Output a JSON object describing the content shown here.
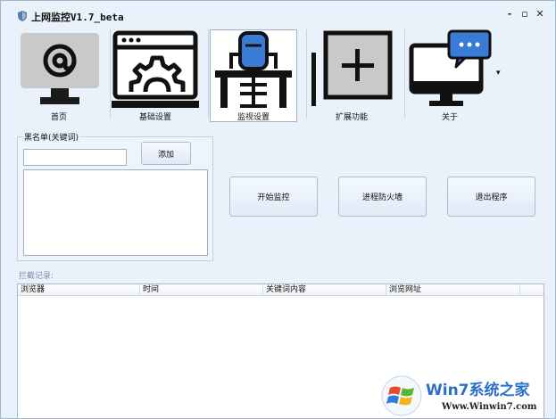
{
  "window": {
    "title": "上网监控V1.7_beta",
    "controls": {
      "min": "-",
      "max": "▫",
      "close": "✕"
    }
  },
  "toolbar": {
    "items": [
      {
        "label": "首页",
        "icon": "at-sign-monitor-icon"
      },
      {
        "label": "基础设置",
        "icon": "gear-window-icon"
      },
      {
        "label": "监视设置",
        "icon": "desk-chair-icon"
      },
      {
        "label": "扩展功能",
        "icon": "plus-box-icon"
      },
      {
        "label": "关于",
        "icon": "chat-monitor-icon"
      }
    ],
    "overflow": "▾"
  },
  "blacklist": {
    "title": "黑名单(关键词)",
    "input_value": "",
    "add_label": "添加"
  },
  "actions": {
    "start": "开始监控",
    "firewall": "进程防火墙",
    "exit": "退出程序"
  },
  "log": {
    "label": "拦截记录:",
    "columns": [
      "浏览器",
      "时间",
      "关键词内容",
      "浏览网址"
    ]
  },
  "watermark": {
    "brand": "Win7系统之家",
    "url": "Www.Winwin7.com"
  },
  "colors": {
    "window_bg": "#e9f2fb",
    "accent_blue": "#3a7bd5",
    "icon_dark": "#111111"
  }
}
